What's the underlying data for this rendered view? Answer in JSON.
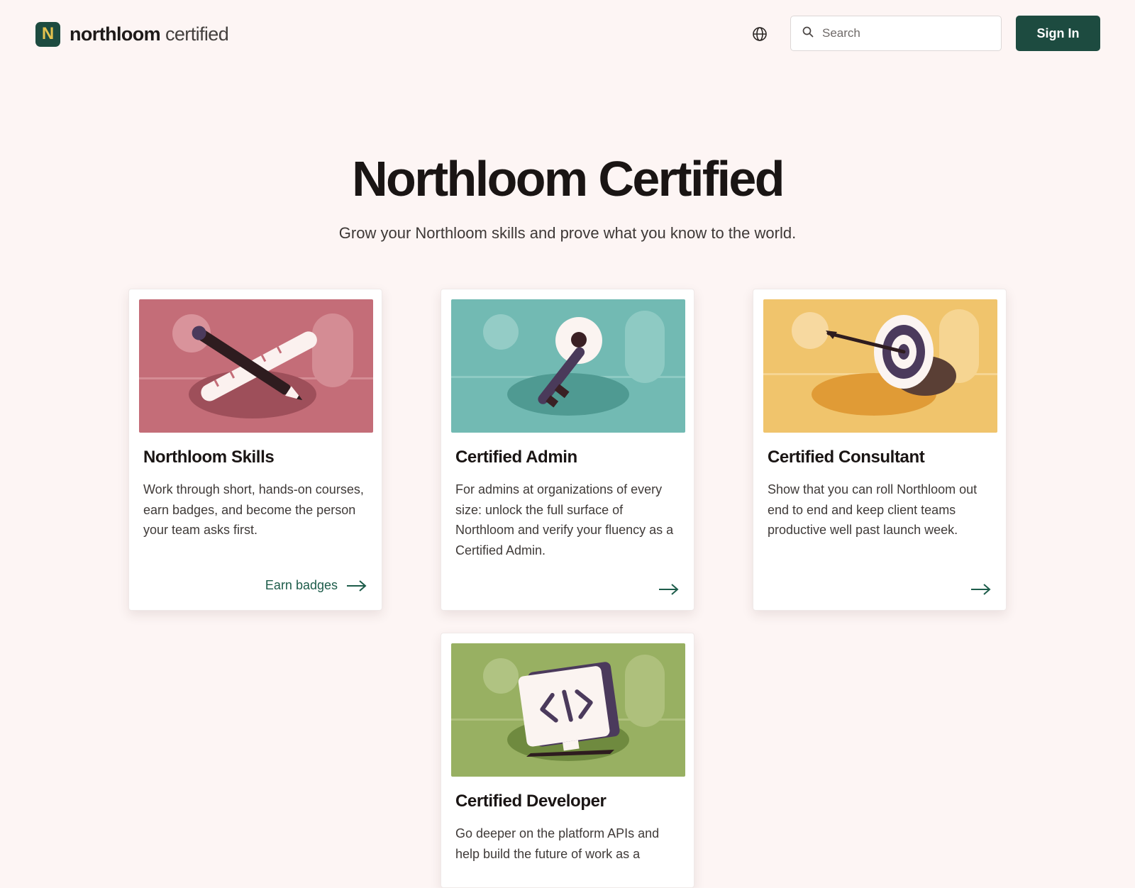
{
  "header": {
    "logo_mark": "N",
    "logo_strong": "northloom",
    "logo_light": "certified",
    "globe_icon": "globe-icon",
    "search_placeholder": "Search",
    "search_icon": "search-icon",
    "signin_label": "Sign In"
  },
  "hero": {
    "title": "Northloom Certified",
    "subtitle": "Grow your Northloom skills and prove what you know to the world."
  },
  "cards": [
    {
      "title": "Northloom Skills",
      "description": "Work through short, hands-on courses, earn badges, and become the person your team asks first.",
      "link_label": "Earn badges",
      "art_icon": "pencil-ruler-icon",
      "art_color": "#c46d78"
    },
    {
      "title": "Certified Admin",
      "description": "For admins at organizations of every size: unlock the full surface of Northloom and verify your fluency as a Certified Admin.",
      "link_label": "",
      "art_icon": "key-icon",
      "art_color": "#72bab3"
    },
    {
      "title": "Certified Consultant",
      "description": "Show that you can roll Northloom out end to end and keep client teams productive well past launch week.",
      "link_label": "",
      "art_icon": "target-arrow-icon",
      "art_color": "#f0c46c"
    },
    {
      "title": "Certified Developer",
      "description": "Go deeper on the platform APIs and help build the future of work as a",
      "link_label": "",
      "art_icon": "code-monitor-icon",
      "art_color": "#98b062"
    }
  ],
  "colors": {
    "page_bg": "#fdf5f4",
    "brand_green": "#1d4b40",
    "brand_yellow": "#e4c24f",
    "link_green": "#1d5c4a"
  }
}
